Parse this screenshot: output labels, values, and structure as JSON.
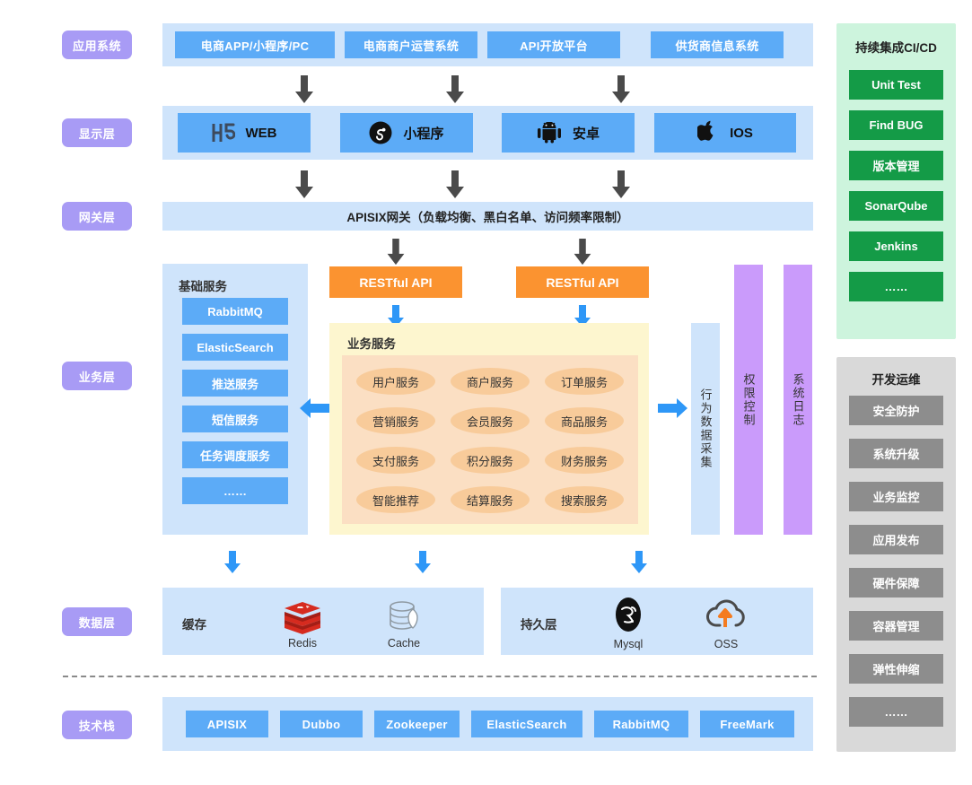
{
  "layers": [
    {
      "id": "app",
      "label": "应用系统"
    },
    {
      "id": "display",
      "label": "显示层"
    },
    {
      "id": "gateway",
      "label": "网关层"
    },
    {
      "id": "business",
      "label": "业务层"
    },
    {
      "id": "data",
      "label": "数据层"
    },
    {
      "id": "stack",
      "label": "技术栈"
    }
  ],
  "app_systems": [
    {
      "label": "电商APP/小程序/PC"
    },
    {
      "label": "电商商户运营系统"
    },
    {
      "label": "API开放平台"
    },
    {
      "label": "供货商信息系统"
    }
  ],
  "display_clients": [
    {
      "label": "WEB",
      "icon": "h5-icon"
    },
    {
      "label": "小程序",
      "icon": "wechat-miniprogram-icon"
    },
    {
      "label": "安卓",
      "icon": "android-icon"
    },
    {
      "label": "IOS",
      "icon": "apple-icon"
    }
  ],
  "gateway": {
    "text": "APISIX网关（负载均衡、黑白名单、访问频率限制）"
  },
  "restful": [
    {
      "label": "RESTful API"
    },
    {
      "label": "RESTful API"
    }
  ],
  "basic_services": {
    "title": "基础服务",
    "items": [
      {
        "label": "RabbitMQ"
      },
      {
        "label": "ElasticSearch"
      },
      {
        "label": "推送服务"
      },
      {
        "label": "短信服务"
      },
      {
        "label": "任务调度服务"
      },
      {
        "label": "……"
      }
    ]
  },
  "business_services": {
    "title": "业务服务",
    "items": [
      {
        "label": "用户服务"
      },
      {
        "label": "商户服务"
      },
      {
        "label": "订单服务"
      },
      {
        "label": "营销服务"
      },
      {
        "label": "会员服务"
      },
      {
        "label": "商品服务"
      },
      {
        "label": "支付服务"
      },
      {
        "label": "积分服务"
      },
      {
        "label": "财务服务"
      },
      {
        "label": "智能推荐"
      },
      {
        "label": "结算服务"
      },
      {
        "label": "搜索服务"
      }
    ]
  },
  "side_columns": [
    {
      "label": "行为数据采集",
      "color": "#cfe4fb"
    },
    {
      "label": "权限控制",
      "color": "#ca9bfb"
    },
    {
      "label": "系统日志",
      "color": "#ca9bfb"
    }
  ],
  "data_layer": {
    "cache": {
      "title": "缓存",
      "items": [
        {
          "label": "Redis",
          "icon": "redis-icon"
        },
        {
          "label": "Cache",
          "icon": "database-icon"
        }
      ]
    },
    "persist": {
      "title": "持久层",
      "items": [
        {
          "label": "Mysql",
          "icon": "mysql-icon"
        },
        {
          "label": "OSS",
          "icon": "oss-cloud-icon"
        }
      ]
    }
  },
  "tech_stack": {
    "items": [
      {
        "label": "APISIX"
      },
      {
        "label": "Dubbo"
      },
      {
        "label": "Zookeeper"
      },
      {
        "label": "ElasticSearch"
      },
      {
        "label": "RabbitMQ"
      },
      {
        "label": "FreeMark"
      }
    ]
  },
  "cicd": {
    "title": "持续集成CI/CD",
    "items": [
      {
        "label": "Unit Test"
      },
      {
        "label": "Find BUG"
      },
      {
        "label": "版本管理"
      },
      {
        "label": "SonarQube"
      },
      {
        "label": "Jenkins"
      },
      {
        "label": "……"
      }
    ]
  },
  "devops": {
    "title": "开发运维",
    "items": [
      {
        "label": "安全防护"
      },
      {
        "label": "系统升级"
      },
      {
        "label": "业务监控"
      },
      {
        "label": "应用发布"
      },
      {
        "label": "硬件保障"
      },
      {
        "label": "容器管理"
      },
      {
        "label": "弹性伸缩"
      },
      {
        "label": "……"
      }
    ]
  },
  "colors": {
    "layer_tag": "#a89bf5",
    "band": "#cfe4fb",
    "chip_blue": "#5cabf7",
    "restful_orange": "#fb9330",
    "biz_panel": "#fdf6cf",
    "biz_inner": "#fbdfc3",
    "pill": "#f8cb9a",
    "purple_col": "#ca9bfb",
    "cicd_bg": "#cdf4dd",
    "cicd_chip": "#149b47",
    "devops_bg": "#d9d9d9",
    "devops_chip": "#8d8d8d",
    "arrow_dark": "#4a4a4a",
    "arrow_blue": "#2e97f7"
  }
}
